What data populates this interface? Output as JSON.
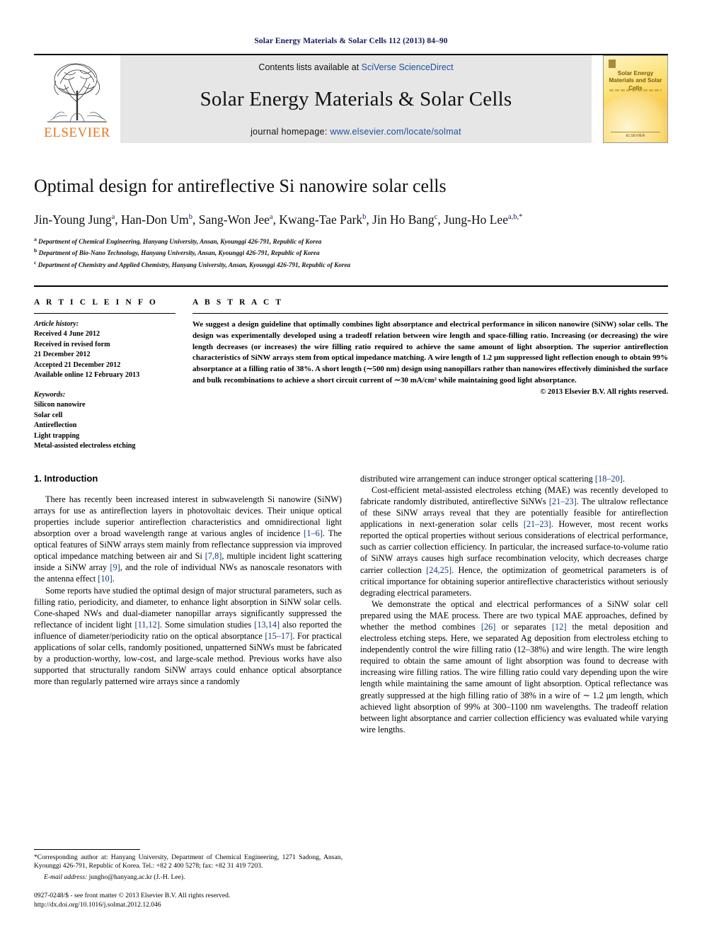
{
  "running_head": "Solar Energy Materials & Solar Cells 112 (2013) 84–90",
  "masthead": {
    "publisher": "ELSEVIER",
    "contents_prefix": "Contents lists available at ",
    "contents_link": "SciVerse ScienceDirect",
    "journal_title": "Solar Energy Materials & Solar Cells",
    "homepage_prefix": "journal homepage: ",
    "homepage_url": "www.elsevier.com/locate/solmat",
    "cover_title": "Solar Energy Materials and Solar Cells",
    "cover_footer": "ELSEVIER"
  },
  "article": {
    "title": "Optimal design for antireflective Si nanowire solar cells",
    "authors": "Jin-Young Jung a, Han-Don Um b, Sang-Won Jee a, Kwang-Tae Park b, Jin Ho Bang c, Jung-Ho Lee a,b,*",
    "affiliations": [
      "a Department of Chemical Engineering, Hanyang University, Ansan, Kyounggi 426-791, Republic of Korea",
      "b Department of Bio-Nano Technology, Hanyang University, Ansan, Kyounggi 426-791, Republic of Korea",
      "c Department of Chemistry and Applied Chemistry, Hanyang University, Ansan, Kyounggi 426-791, Republic of Korea"
    ]
  },
  "article_info": {
    "heading": "A R T I C L E   I N F O",
    "history_label": "Article history:",
    "history": [
      "Received 4 June 2012",
      "Received in revised form",
      "21 December 2012",
      "Accepted 21 December 2012",
      "Available online 12 February 2013"
    ],
    "keywords_label": "Keywords:",
    "keywords": [
      "Silicon nanowire",
      "Solar cell",
      "Antireflection",
      "Light trapping",
      "Metal-assisted electroless etching"
    ]
  },
  "abstract": {
    "heading": "A B S T R A C T",
    "text": "We suggest a design guideline that optimally combines light absorptance and electrical performance in silicon nanowire (SiNW) solar cells. The design was experimentally developed using a tradeoff relation between wire length and space-filling ratio. Increasing (or decreasing) the wire length decreases (or increases) the wire filling ratio required to achieve the same amount of light absorption. The superior antireflection characteristics of SiNW arrays stem from optical impedance matching. A wire length of 1.2 μm suppressed light reflection enough to obtain 99% absorptance at a filling ratio of 38%. A short length (∼500 nm) design using nanopillars rather than nanowires effectively diminished the surface and bulk recombinations to achieve a short circuit current of ∼30 mA/cm² while maintaining good light absorptance.",
    "copyright": "© 2013 Elsevier B.V. All rights reserved."
  },
  "introduction": {
    "heading": "1.  Introduction",
    "left_paragraphs": [
      "There has recently been increased interest in subwavelength Si nanowire (SiNW) arrays for use as antireflection layers in photovoltaic devices. Their unique optical properties include superior antireflection characteristics and omnidirectional light absorption over a broad wavelength range at various angles of incidence [1–6]. The optical features of SiNW arrays stem mainly from reflectance suppression via improved optical impedance matching between air and Si [7,8], multiple incident light scattering inside a SiNW array [9], and the role of individual NWs as nanoscale resonators with the antenna effect [10].",
      "Some reports have studied the optimal design of major structural parameters, such as filling ratio, periodicity, and diameter, to enhance light absorption in SiNW solar cells. Cone-shaped NWs and dual-diameter nanopillar arrays significantly suppressed the reflectance of incident light [11,12]. Some simulation studies [13,14] also reported the influence of diameter/periodicity ratio on the optical absorptance [15–17]. For practical applications of solar cells, randomly positioned, unpatterned SiNWs must be fabricated by a production-worthy, low-cost, and large-scale method. Previous works have also supported that structurally random SiNW arrays could enhance optical absorptance more than regularly patterned wire arrays since a randomly"
    ],
    "right_paragraphs": [
      "distributed wire arrangement can induce stronger optical scattering [18–20].",
      "Cost-efficient metal-assisted electroless etching (MAE) was recently developed to fabricate randomly distributed, antireflective SiNWs [21–23]. The ultralow reflectance of these SiNW arrays reveal that they are potentially feasible for antireflection applications in next-generation solar cells [21–23]. However, most recent works reported the optical properties without serious considerations of electrical performance, such as carrier collection efficiency. In particular, the increased surface-to-volume ratio of SiNW arrays causes high surface recombination velocity, which decreases charge carrier collection [24,25]. Hence, the optimization of geometrical parameters is of critical importance for obtaining superior antireflective characteristics without seriously degrading electrical parameters.",
      "We demonstrate the optical and electrical performances of a SiNW solar cell prepared using the MAE process. There are two typical MAE approaches, defined by whether the method combines [26] or separates [12] the metal deposition and electroless etching steps. Here, we separated Ag deposition from electroless etching to independently control the wire filling ratio (12–38%) and wire length. The wire length required to obtain the same amount of light absorption was found to decrease with increasing wire filling ratios. The wire filling ratio could vary depending upon the wire length while maintaining the same amount of light absorption. Optical reflectance was greatly suppressed at the high filling ratio of 38% in a wire of ∼ 1.2 μm length, which achieved light absorption of 99% at 300–1100 nm wavelengths. The tradeoff relation between light absorptance and carrier collection efficiency was evaluated while varying wire lengths."
    ]
  },
  "footnotes": {
    "corresponding": "*Corresponding author at: Hanyang University, Department of Chemical Engineering, 1271 Sadong, Ansan, Kyounggi 426-791, Republic of Korea. Tel.: +82 2 400 5278; fax: +82 31 419 7203.",
    "email_label": "E-mail address:",
    "email_value": "jungho@hanyang.ac.kr (J.-H. Lee).",
    "issn_line": "0927-0248/$ - see front matter © 2013 Elsevier B.V. All rights reserved.",
    "doi_line": "http://dx.doi.org/10.1016/j.solmat.2012.12.046"
  },
  "colors": {
    "link": "#1a4f9c",
    "reference": "#16387a",
    "elsevier_orange": "#e87722",
    "running_head": "#16185c"
  }
}
